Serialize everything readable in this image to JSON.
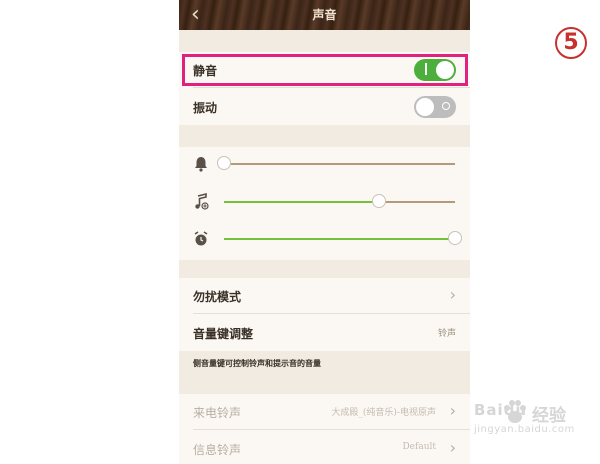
{
  "header": {
    "title": "声音",
    "back_icon": "chevron-left-icon"
  },
  "mute": {
    "label": "静音",
    "state": "on"
  },
  "vibrate": {
    "label": "振动",
    "state": "off"
  },
  "volume": {
    "ringer": {
      "icon": "bell-icon",
      "level": 0.0
    },
    "media": {
      "icon": "music-note-icon",
      "level": 0.67
    },
    "alarm": {
      "icon": "alarm-clock-icon",
      "level": 1.0
    }
  },
  "dnd": {
    "label": "勿扰模式"
  },
  "volume_keys": {
    "label": "音量键调整",
    "value": "铃声"
  },
  "note": "侧音量键可控制铃声和提示音的音量",
  "ringtone": {
    "label": "来电铃声",
    "value": "大成殿_(纯音乐)-电视原声"
  },
  "message_tone": {
    "label": "信息铃声",
    "value": "Default"
  },
  "step_badge": "5",
  "watermark": {
    "brand": "Baidu",
    "suffix": "经验",
    "url": "jingyan.baidu.com"
  },
  "colors": {
    "toggle_on": "#4caf3c",
    "highlight": "#e0217d",
    "step": "#c8302e"
  }
}
